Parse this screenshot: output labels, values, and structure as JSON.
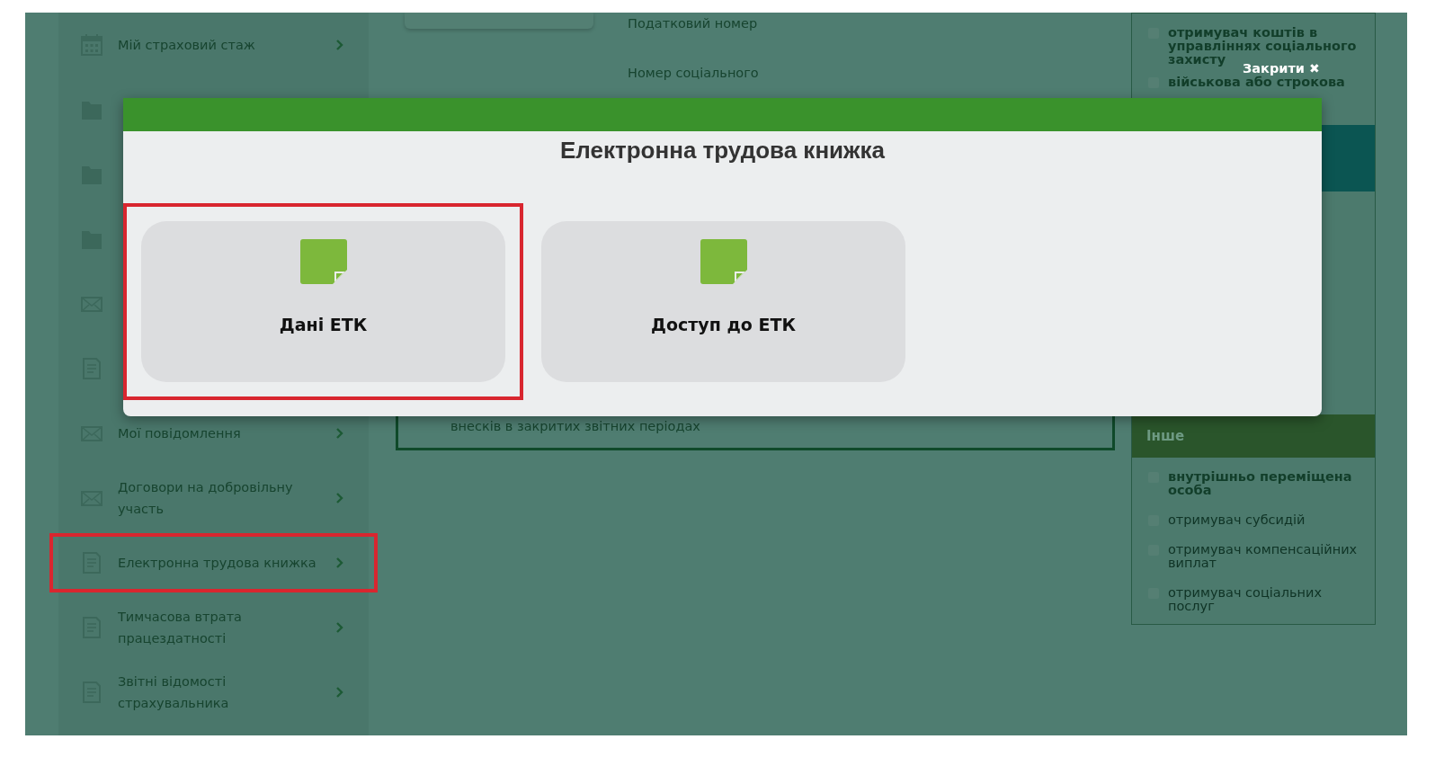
{
  "sidebar": {
    "items": [
      {
        "kind": "calendar",
        "label": "Мій страховий стаж",
        "highlighted": false
      },
      {
        "kind": "folder",
        "highlighted": false
      },
      {
        "kind": "folder",
        "highlighted": false
      },
      {
        "kind": "folder",
        "highlighted": false
      },
      {
        "kind": "mail",
        "highlighted": false
      },
      {
        "kind": "document",
        "highlighted": false
      },
      {
        "kind": "mail",
        "label": "Мої повідомлення",
        "highlighted": false
      },
      {
        "kind": "mail",
        "label": "Договори на добровільну участь",
        "highlighted": false
      },
      {
        "kind": "document",
        "label": "Електронна трудова книжка",
        "highlighted": true
      },
      {
        "kind": "document",
        "label": "Тимчасова втрата працездатності",
        "highlighted": false
      },
      {
        "kind": "document",
        "label": "Звітні відомості страхувальника",
        "highlighted": false
      }
    ]
  },
  "profile": {
    "fields": [
      "Податковий номер",
      "Номер соціального"
    ]
  },
  "contributions": {
    "text": "внесків в закритих звітних періодах"
  },
  "categories": {
    "top_items": [
      {
        "label": "отримувач коштів в управліннях соціального захисту",
        "checked": false,
        "disabled": false
      },
      {
        "label": "військова або строкова",
        "checked": false,
        "disabled": false
      }
    ],
    "other": {
      "title": "Інше",
      "items": [
        {
          "label": "внутрішньо переміщена особа",
          "checked": false,
          "disabled": false
        },
        {
          "label": "отримувач субсидій",
          "checked": false,
          "disabled": true
        },
        {
          "label": "отримувач компенсаційних виплат",
          "checked": false,
          "disabled": true
        },
        {
          "label": "отримувач соціальних послуг",
          "checked": false,
          "disabled": true
        }
      ]
    }
  },
  "modal": {
    "title": "Електронна трудова книжка",
    "close": {
      "label": "Закрити",
      "icon": "✖"
    },
    "tiles": [
      {
        "label": "Дані ЕТК",
        "highlighted": true
      },
      {
        "label": "Доступ до ЕТК",
        "highlighted": false
      }
    ]
  }
}
